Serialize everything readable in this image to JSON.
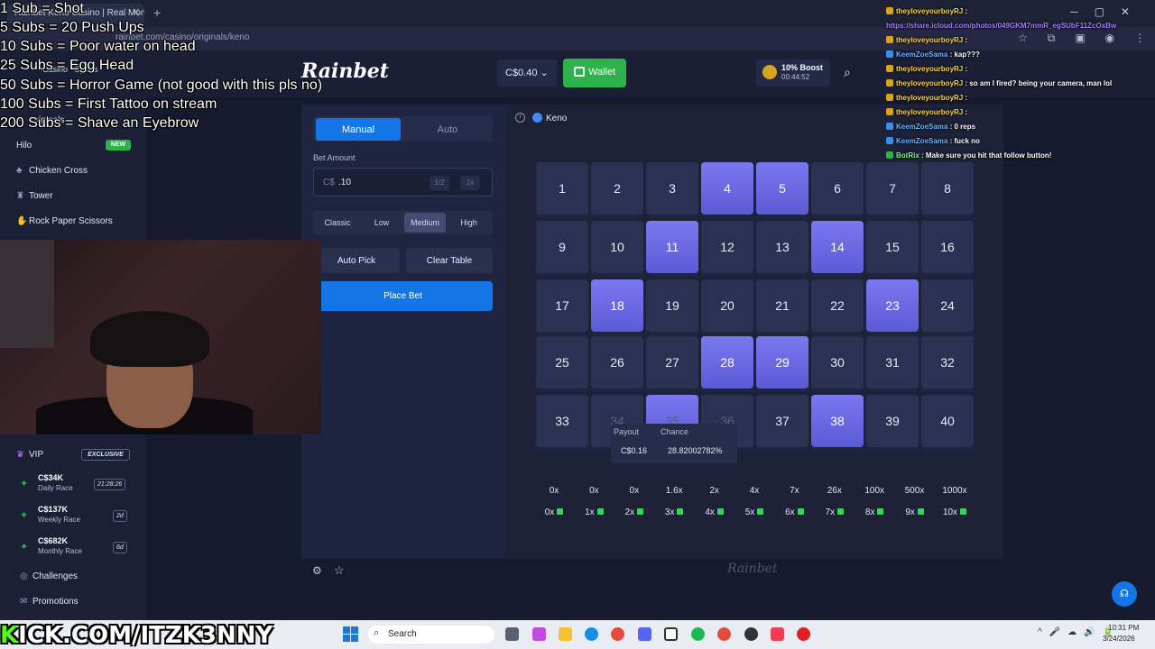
{
  "browser": {
    "tab_title": "Rainbet Keno Casino | Real Money",
    "url": "rainbet.com/casino/originals/keno"
  },
  "header": {
    "balance": "C$0.40",
    "wallet_label": "Wallet",
    "boost_title": "10% Boost",
    "boost_timer": "00:44:52"
  },
  "sidebar": {
    "tabs": [
      "Casino",
      "Sports"
    ],
    "originals_label": "Originals",
    "items": [
      {
        "label": "Hilo",
        "badge": "NEW"
      },
      {
        "label": "Chicken Cross"
      },
      {
        "label": "Tower"
      },
      {
        "label": "Rock Paper Scissors"
      }
    ],
    "vip_label": "VIP",
    "vip_badge": "EXCLUSIVE",
    "races": [
      {
        "amount": "C$34K",
        "label": "Daily Race",
        "tag": "21:28:26"
      },
      {
        "amount": "C$137K",
        "label": "Weekly Race",
        "tag": "2d"
      },
      {
        "amount": "C$682K",
        "label": "Monthly Race",
        "tag": "6d"
      }
    ],
    "challenges_label": "Challenges",
    "promotions_label": "Promotions"
  },
  "controls": {
    "mode_manual": "Manual",
    "mode_auto": "Auto",
    "bet_label": "Bet Amount",
    "bet_currency": "C$",
    "bet_value": ".10",
    "half_label": "1/2",
    "double_label": "2x",
    "risk_levels": [
      "Classic",
      "Low",
      "Medium",
      "High"
    ],
    "risk_selected": "Medium",
    "auto_pick_label": "Auto Pick",
    "clear_table_label": "Clear Table",
    "place_bet_label": "Place Bet"
  },
  "game": {
    "title": "Keno",
    "numbers": [
      1,
      2,
      3,
      4,
      5,
      6,
      7,
      8,
      9,
      10,
      11,
      12,
      13,
      14,
      15,
      16,
      17,
      18,
      19,
      20,
      21,
      22,
      23,
      24,
      25,
      26,
      27,
      28,
      29,
      30,
      31,
      32,
      33,
      34,
      35,
      36,
      37,
      38,
      39,
      40
    ],
    "selected": [
      4,
      5,
      11,
      14,
      18,
      23,
      28,
      29,
      35,
      38
    ],
    "payout_label": "Payout",
    "chance_label": "Chance",
    "payout_value": "C$0.16",
    "chance_value": "28.82002782%",
    "multipliers": [
      "0x",
      "0x",
      "0x",
      "1.6x",
      "2x",
      "4x",
      "7x",
      "26x",
      "100x",
      "500x",
      "1000x"
    ],
    "hits": [
      "0x",
      "1x",
      "2x",
      "3x",
      "4x",
      "5x",
      "6x",
      "7x",
      "8x",
      "9x",
      "10x"
    ],
    "footer_logo": "Rainbet"
  },
  "overlay": {
    "sub_goals": [
      "1 Sub = Shot",
      "5 Subs = 20 Push Ups",
      "10 Subs = Poor water on head",
      "25 Subs = Egg Head",
      "50 Subs =  Horror Game (not good with this pls no)",
      "100 Subs = First Tattoo on stream",
      "200 Subs =  Shave an Eyebrow"
    ],
    "kick_k": "K",
    "kick_rest": "ICK.COM/ITZK3NNY"
  },
  "chat": [
    {
      "user": "theyloveyourboyRJ",
      "msg": "",
      "color": "yellow",
      "badge": "#d9a416"
    },
    {
      "user": "",
      "msg": "https://share.icloud.com/photos/049GKM7mmR_egSUbF11ZcOxBw",
      "color": "link",
      "badge": ""
    },
    {
      "user": "theyloveyourboyRJ",
      "msg": "",
      "color": "yellow",
      "badge": "#d9a416"
    },
    {
      "user": "KeemZoeSama",
      "msg": "kap???",
      "color": "blue",
      "badge": "#3b8df0"
    },
    {
      "user": "theyloveyourboyRJ",
      "msg": "",
      "color": "yellow",
      "badge": "#d9a416"
    },
    {
      "user": "theyloveyourboyRJ",
      "msg": "so am I fired? being your camera, man lol",
      "color": "yellow",
      "badge": "#d9a416"
    },
    {
      "user": "theyloveyourboyRJ",
      "msg": "",
      "color": "yellow",
      "badge": "#d9a416"
    },
    {
      "user": "theyloveyourboyRJ",
      "msg": "",
      "color": "yellow",
      "badge": "#d9a416"
    },
    {
      "user": "KeemZoeSama",
      "msg": "0 reps",
      "color": "blue",
      "badge": "#3b8df0"
    },
    {
      "user": "KeemZoeSama",
      "msg": "fuck no",
      "color": "blue",
      "badge": "#3b8df0"
    },
    {
      "user": "BotRix",
      "msg": "Make sure you hit that follow button!",
      "color": "green",
      "badge": "#2eb24c"
    }
  ],
  "taskbar": {
    "search_label": "Search",
    "time": "10:31 PM",
    "date": "3/24/2026"
  }
}
